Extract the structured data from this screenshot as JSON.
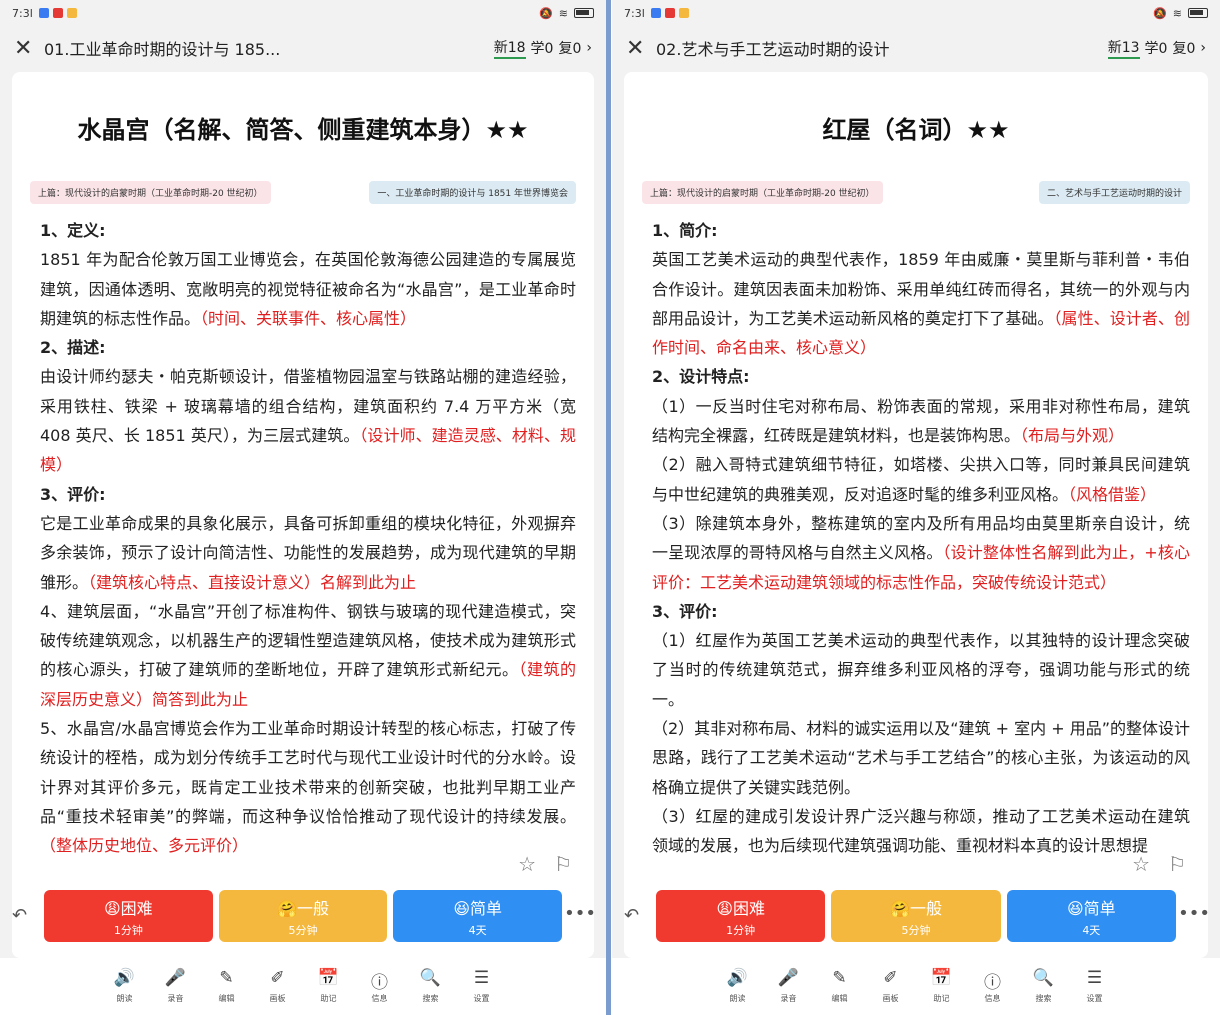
{
  "left": {
    "status_time": "7:3l",
    "header": {
      "title": "01.工业革命时期的设计与 185...",
      "new_label": "新18",
      "learn_label": "学0",
      "review_label": "复0",
      "chevron": "›"
    },
    "card": {
      "title": "水晶宫（名解、简答、侧重建筑本身）★★",
      "tag_left": "上篇：现代设计的启蒙时期（工业革命时期-20 世纪初）",
      "tag_right": "一、工业革命时期的设计与 1851 年世界博览会",
      "paragraphs": [
        {
          "type": "heading",
          "text": "1、定义:"
        },
        {
          "type": "text",
          "text": "1851 年为配合伦敦万国工业博览会，在英国伦敦海德公园建造的专属展览建筑，因通体透明、宽敞明亮的视觉特征被命名为“水晶宫”，是工业革命时期建筑的标志性作品。",
          "note": "（时间、关联事件、核心属性）"
        },
        {
          "type": "heading",
          "text": "2、描述:"
        },
        {
          "type": "text",
          "text": "由设计师约瑟夫・帕克斯顿设计，借鉴植物园温室与铁路站棚的建造经验，采用铁柱、铁梁 + 玻璃幕墙的组合结构，建筑面积约 7.4 万平方米（宽 408 英尺、长 1851 英尺），为三层式建筑。",
          "note": "（设计师、建造灵感、材料、规模）"
        },
        {
          "type": "heading",
          "text": "3、评价:"
        },
        {
          "type": "text",
          "text": "它是工业革命成果的具象化展示，具备可拆卸重组的模块化特征，外观摒弃多余装饰，预示了设计向简洁性、功能性的发展趋势，成为现代建筑的早期雏形。",
          "note": "（建筑核心特点、直接设计意义）名解到此为止"
        },
        {
          "type": "text",
          "text": "4、建筑层面，“水晶宫”开创了标准构件、钢铁与玻璃的现代建造模式，突破传统建筑观念，以机器生产的逻辑性塑造建筑风格，使技术成为建筑形式的核心源头，打破了建筑师的垄断地位，开辟了建筑形式新纪元。",
          "note": "（建筑的深层历史意义）简答到此为止"
        },
        {
          "type": "text",
          "text": "5、水晶宫/水晶宫博览会作为工业革命时期设计转型的核心标志，打破了传统设计的桎梏，成为划分传统手工艺时代与现代工业设计时代的分水岭。设计界对其评价多元，既肯定工业技术带来的创新突破，也批判早期工业产品“重技术轻审美”的弊端，而这种争议恰恰推动了现代设计的持续发展。",
          "note": "（整体历史地位、多元评价）"
        }
      ]
    },
    "buttons": [
      {
        "label": "😩困难",
        "sub": "1分钟"
      },
      {
        "label": "🤗一般",
        "sub": "5分钟"
      },
      {
        "label": "😆简单",
        "sub": "4天"
      }
    ]
  },
  "right": {
    "status_time": "7:3l",
    "header": {
      "title": "02.艺术与手工艺运动时期的设计",
      "new_label": "新13",
      "learn_label": "学0",
      "review_label": "复0",
      "chevron": "›"
    },
    "card": {
      "title": "红屋（名词）★★",
      "tag_left": "上篇：现代设计的启蒙时期（工业革命时期-20 世纪初）",
      "tag_right": "二、艺术与手工艺运动时期的设计",
      "paragraphs": [
        {
          "type": "heading",
          "text": "1、简介:"
        },
        {
          "type": "text",
          "text": "英国工艺美术运动的典型代表作，1859 年由威廉・莫里斯与菲利普・韦伯合作设计。建筑因表面未加粉饰、采用单纯红砖而得名，其统一的外观与内部用品设计，为工艺美术运动新风格的奠定打下了基础。",
          "note": "（属性、设计者、创作时间、命名由来、核心意义）"
        },
        {
          "type": "heading",
          "text": "2、设计特点:"
        },
        {
          "type": "text",
          "text": "（1）一反当时住宅对称布局、粉饰表面的常规，采用非对称性布局，建筑结构完全裸露，红砖既是建筑材料，也是装饰构思。",
          "note": "（布局与外观）"
        },
        {
          "type": "text",
          "text": "（2）融入哥特式建筑细节特征，如塔楼、尖拱入口等，同时兼具民间建筑与中世纪建筑的典雅美观，反对追逐时髦的维多利亚风格。",
          "note": "（风格借鉴）"
        },
        {
          "type": "text",
          "text": "（3）除建筑本身外，整栋建筑的室内及所有用品均由莫里斯亲自设计，统一呈现浓厚的哥特风格与自然主义风格。",
          "note": "（设计整体性名解到此为止，+核心评价：工艺美术运动建筑领域的标志性作品，突破传统设计范式）"
        },
        {
          "type": "heading",
          "text": "3、评价:"
        },
        {
          "type": "text",
          "text": "（1）红屋作为英国工艺美术运动的典型代表作，以其独特的设计理念突破了当时的传统建筑范式，摒弃维多利亚风格的浮夸，强调功能与形式的统一。",
          "note": ""
        },
        {
          "type": "text",
          "text": "（2）其非对称布局、材料的诚实运用以及“建筑 + 室内 + 用品”的整体设计思路，践行了工艺美术运动“艺术与手工艺结合”的核心主张，为该运动的风格确立提供了关键实践范例。",
          "note": ""
        },
        {
          "type": "text",
          "text": "（3）红屋的建成引发设计界广泛兴趣与称颂，推动了工艺美术运动在建筑领域的发展，也为后续现代建筑强调功能、重视材料本真的设计思想提",
          "note": ""
        }
      ]
    },
    "buttons": [
      {
        "label": "😩困难",
        "sub": "1分钟"
      },
      {
        "label": "🤗一般",
        "sub": "5分钟"
      },
      {
        "label": "😆简单",
        "sub": "4天"
      }
    ]
  },
  "nav": [
    {
      "icon": "🔊",
      "label": "朗读"
    },
    {
      "icon": "🎤",
      "label": "录音"
    },
    {
      "icon": "✎",
      "label": "编辑"
    },
    {
      "icon": "✐",
      "label": "画板"
    },
    {
      "icon": "📅",
      "label": "助记"
    },
    {
      "icon": "ⓘ",
      "label": "信息"
    },
    {
      "icon": "🔍",
      "label": "搜索"
    },
    {
      "icon": "☰",
      "label": "设置"
    }
  ],
  "icons": {
    "close": "✕",
    "star": "☆",
    "flag": "⚐",
    "undo": "↶",
    "more": "•••"
  },
  "colors": {
    "hard": "#f13a2f",
    "mid": "#f5b83f",
    "easy": "#2f8ff2",
    "note": "#e02020"
  }
}
